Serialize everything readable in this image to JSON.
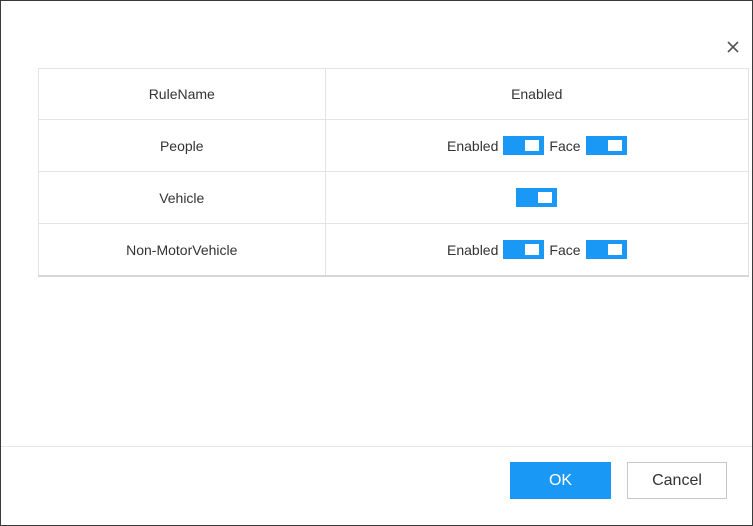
{
  "dialog": {
    "close_icon": "close-icon",
    "table": {
      "headers": [
        "RuleName",
        "Enabled"
      ],
      "rows": [
        {
          "name": "People",
          "enabled_label": "Enabled",
          "enabled_on": true,
          "face_label": "Face",
          "face_on": true
        },
        {
          "name": "Vehicle",
          "enabled_on": true
        },
        {
          "name": "Non-MotorVehicle",
          "enabled_label": "Enabled",
          "enabled_on": true,
          "face_label": "Face",
          "face_on": true
        }
      ]
    },
    "footer": {
      "ok_label": "OK",
      "cancel_label": "Cancel"
    }
  },
  "colors": {
    "accent": "#1a98f5",
    "border": "#e3e3e3"
  }
}
